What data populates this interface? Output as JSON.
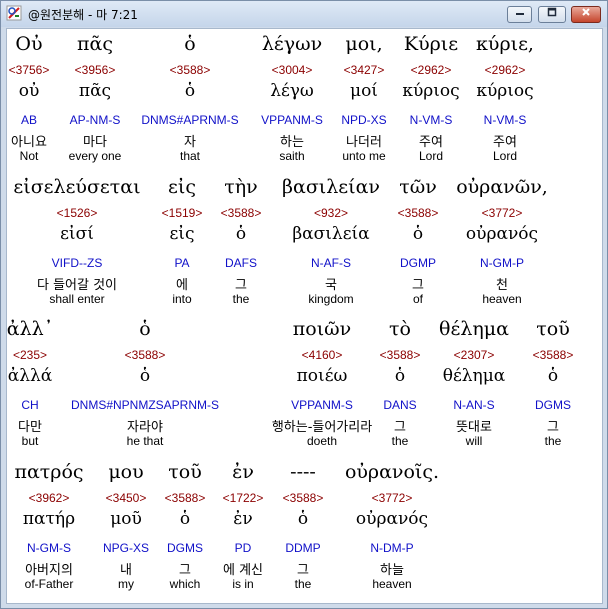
{
  "window": {
    "title": "@원전분해 - 마 7:21"
  },
  "icons": {
    "app": "app-logo-icon",
    "minimize": "minimize-icon",
    "maximize": "maximize-icon",
    "close": "close-icon"
  },
  "colors": {
    "strongs": "#8b0000",
    "parsing": "#1010c8",
    "greek": "#000000"
  },
  "rows": [
    {
      "words": [
        {
          "greek": "Οὐ",
          "strongs": "<3756>",
          "lemma": "οὐ",
          "parsing": "AB",
          "korean": "아니요",
          "english": "Not"
        },
        {
          "greek": "πᾶς",
          "strongs": "<3956>",
          "lemma": "πᾶς",
          "parsing": "AP-NM-S",
          "korean": "마다",
          "english": "every one"
        },
        {
          "greek": "ὁ",
          "strongs": "<3588>",
          "lemma": "ὁ",
          "parsing": "DNMS#APRNM-S",
          "korean": "자",
          "english": "that"
        },
        {
          "greek": "λέγων",
          "strongs": "<3004>",
          "lemma": "λέγω",
          "parsing": "VPPANM-S",
          "korean": "하는",
          "english": "saith"
        },
        {
          "greek": "μοι,",
          "strongs": "<3427>",
          "lemma": "μοί",
          "parsing": "NPD-XS",
          "korean": "나더러",
          "english": "unto me"
        },
        {
          "greek": "Κύριε",
          "strongs": "<2962>",
          "lemma": "κύριος",
          "parsing": "N-VM-S",
          "korean": "주여",
          "english": "Lord"
        },
        {
          "greek": "κύριε,",
          "strongs": "<2962>",
          "lemma": "κύριος",
          "parsing": "N-VM-S",
          "korean": "주여",
          "english": "Lord"
        }
      ]
    },
    {
      "words": [
        {
          "greek": "εἰσελεύσεται",
          "strongs": "<1526>",
          "lemma": "εἰσί",
          "parsing": "VIFD--ZS",
          "korean": "다 들어갈 것이",
          "english": "shall enter"
        },
        {
          "greek": "εἰς",
          "strongs": "<1519>",
          "lemma": "εἰς",
          "parsing": "PA",
          "korean": "에",
          "english": "into"
        },
        {
          "greek": "τὴν",
          "strongs": "<3588>",
          "lemma": "ὁ",
          "parsing": "DAFS",
          "korean": "그",
          "english": "the"
        },
        {
          "greek": "βασιλείαν",
          "strongs": "<932>",
          "lemma": "βασιλεία",
          "parsing": "N-AF-S",
          "korean": "국",
          "english": "kingdom"
        },
        {
          "greek": "τῶν",
          "strongs": "<3588>",
          "lemma": "ὁ",
          "parsing": "DGMP",
          "korean": "그",
          "english": "of"
        },
        {
          "greek": "οὐρανῶν,",
          "strongs": "<3772>",
          "lemma": "οὐρανός",
          "parsing": "N-GM-P",
          "korean": "천",
          "english": "heaven"
        }
      ]
    },
    {
      "words": [
        {
          "greek": "ἀλλ᾽",
          "strongs": "<235>",
          "lemma": "ἀλλά",
          "parsing": "CH",
          "korean": "다만",
          "english": "but"
        },
        {
          "greek": "ὁ",
          "strongs": "<3588>",
          "lemma": "ὁ",
          "parsing": "DNMS#NPNMZSAPRNM-S",
          "korean": "자라야",
          "english": "he that"
        },
        {
          "greek": "ποιῶν",
          "strongs": "<4160>",
          "lemma": "ποιέω",
          "parsing": "VPPANM-S",
          "korean": "행하는-들어가리라",
          "english": "doeth"
        },
        {
          "greek": "τὸ",
          "strongs": "<3588>",
          "lemma": "ὁ",
          "parsing": "DANS",
          "korean": "그",
          "english": "the"
        },
        {
          "greek": "θέλημα",
          "strongs": "<2307>",
          "lemma": "θέλημα",
          "parsing": "N-AN-S",
          "korean": "뜻대로",
          "english": "will"
        },
        {
          "greek": "τοῦ",
          "strongs": "<3588>",
          "lemma": "ὁ",
          "parsing": "DGMS",
          "korean": "그",
          "english": "the"
        }
      ]
    },
    {
      "words": [
        {
          "greek": "πατρός",
          "strongs": "<3962>",
          "lemma": "πατήρ",
          "parsing": "N-GM-S",
          "korean": "아버지의",
          "english": "of-Father"
        },
        {
          "greek": "μου",
          "strongs": "<3450>",
          "lemma": "μοῦ",
          "parsing": "NPG-XS",
          "korean": "내",
          "english": "my"
        },
        {
          "greek": "τοῦ",
          "strongs": "<3588>",
          "lemma": "ὁ",
          "parsing": "DGMS",
          "korean": "그",
          "english": "which"
        },
        {
          "greek": "ἐν",
          "strongs": "<1722>",
          "lemma": "ἐν",
          "parsing": "PD",
          "korean": "에 계신",
          "english": "is in"
        },
        {
          "greek": "----",
          "strongs": "<3588>",
          "lemma": "ὁ",
          "parsing": "DDMP",
          "korean": "그",
          "english": "the"
        },
        {
          "greek": "οὐρανοῖς.",
          "strongs": "<3772>",
          "lemma": "οὐρανός",
          "parsing": "N-DM-P",
          "korean": "하늘",
          "english": "heaven"
        }
      ]
    }
  ]
}
